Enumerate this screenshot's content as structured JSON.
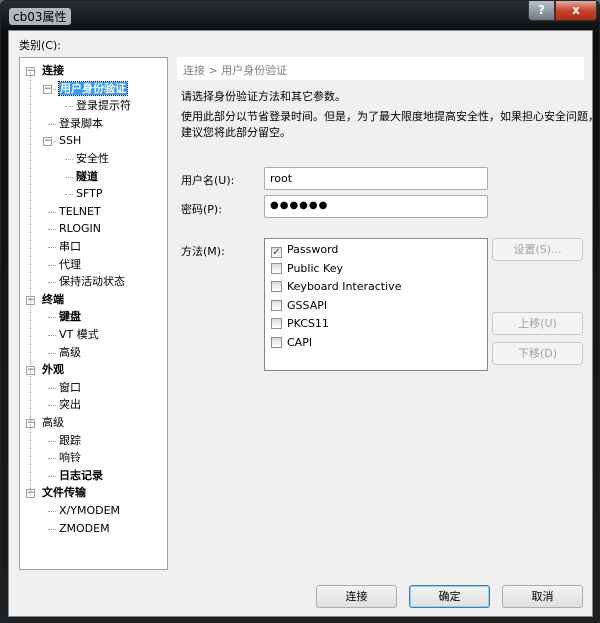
{
  "window": {
    "title": "cb03属性",
    "help_label": "?",
    "close_label": "x"
  },
  "category_label": "类别(C):",
  "tree": [
    {
      "label": "连接",
      "level": 0,
      "bold": true,
      "expander": "−"
    },
    {
      "label": "用户身份验证",
      "level": 1,
      "bold": true,
      "expander": "−",
      "selected": true
    },
    {
      "label": "登录提示符",
      "level": 2
    },
    {
      "label": "登录脚本",
      "level": 1
    },
    {
      "label": "SSH",
      "level": 1,
      "expander": "−"
    },
    {
      "label": "安全性",
      "level": 2
    },
    {
      "label": "隧道",
      "level": 2,
      "bold": true
    },
    {
      "label": "SFTP",
      "level": 2
    },
    {
      "label": "TELNET",
      "level": 1
    },
    {
      "label": "RLOGIN",
      "level": 1
    },
    {
      "label": "串口",
      "level": 1
    },
    {
      "label": "代理",
      "level": 1
    },
    {
      "label": "保持活动状态",
      "level": 1
    },
    {
      "label": "终端",
      "level": 0,
      "bold": true,
      "expander": "−"
    },
    {
      "label": "键盘",
      "level": 1,
      "bold": true
    },
    {
      "label": "VT 模式",
      "level": 1
    },
    {
      "label": "高级",
      "level": 1
    },
    {
      "label": "外观",
      "level": 0,
      "bold": true,
      "expander": "−"
    },
    {
      "label": "窗口",
      "level": 1
    },
    {
      "label": "突出",
      "level": 1
    },
    {
      "label": "高级",
      "level": 0,
      "expander": "−"
    },
    {
      "label": "跟踪",
      "level": 1
    },
    {
      "label": "响铃",
      "level": 1
    },
    {
      "label": "日志记录",
      "level": 1,
      "bold": true
    },
    {
      "label": "文件传输",
      "level": 0,
      "bold": true,
      "expander": "−"
    },
    {
      "label": "X/YMODEM",
      "level": 1
    },
    {
      "label": "ZMODEM",
      "level": 1
    }
  ],
  "breadcrumb": "连接 > 用户身份验证",
  "desc1": "请选择身份验证方法和其它参数。",
  "desc2": "使用此部分以节省登录时间。但是，为了最大限度地提高安全性，如果担心安全问题，",
  "desc3": "建议您将此部分留空。",
  "username": {
    "label": "用户名(U):",
    "value": "root"
  },
  "password": {
    "label": "密码(P):",
    "value": "●●●●●●"
  },
  "method_label": "方法(M):",
  "methods": [
    {
      "label": "Password",
      "checked": true
    },
    {
      "label": "Public Key",
      "checked": false
    },
    {
      "label": "Keyboard Interactive",
      "checked": false
    },
    {
      "label": "GSSAPI",
      "checked": false
    },
    {
      "label": "PKCS11",
      "checked": false
    },
    {
      "label": "CAPI",
      "checked": false
    }
  ],
  "side_buttons": {
    "settings": "设置(S)...",
    "move_up": "上移(U)",
    "move_down": "下移(D)"
  },
  "footer": {
    "connect": "连接",
    "ok": "确定",
    "cancel": "取消"
  }
}
